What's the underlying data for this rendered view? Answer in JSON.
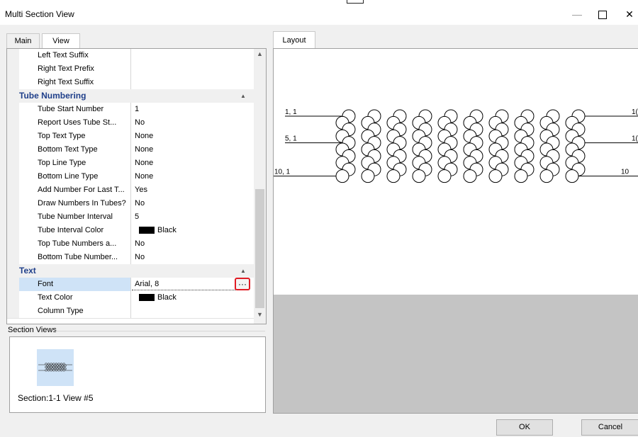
{
  "window": {
    "title": "Multi Section View"
  },
  "left_tabs": [
    {
      "label": "Main"
    },
    {
      "label": "View"
    }
  ],
  "properties": [
    {
      "type": "prop",
      "name": "Left Text Suffix",
      "value": ""
    },
    {
      "type": "prop",
      "name": "Right Text Prefix",
      "value": ""
    },
    {
      "type": "prop",
      "name": "Right Text Suffix",
      "value": ""
    },
    {
      "type": "cat",
      "name": "Tube Numbering"
    },
    {
      "type": "prop",
      "name": "Tube Start Number",
      "value": "1"
    },
    {
      "type": "prop",
      "name": "Report Uses Tube St...",
      "value": "No"
    },
    {
      "type": "prop",
      "name": "Top Text Type",
      "value": "None"
    },
    {
      "type": "prop",
      "name": "Bottom Text Type",
      "value": "None"
    },
    {
      "type": "prop",
      "name": "Top Line Type",
      "value": "None"
    },
    {
      "type": "prop",
      "name": "Bottom Line Type",
      "value": "None"
    },
    {
      "type": "prop",
      "name": "Add Number For Last T...",
      "value": "Yes"
    },
    {
      "type": "prop",
      "name": "Draw Numbers In Tubes?",
      "value": "No"
    },
    {
      "type": "prop",
      "name": "Tube Number Interval",
      "value": "5"
    },
    {
      "type": "color",
      "name": "Tube Interval Color",
      "value": "Black",
      "swatch": "#000000"
    },
    {
      "type": "prop",
      "name": "Top Tube Numbers a...",
      "value": "No"
    },
    {
      "type": "prop",
      "name": "Bottom Tube Number...",
      "value": "No"
    },
    {
      "type": "cat",
      "name": "Text"
    },
    {
      "type": "font",
      "name": "Font",
      "value": "Arial, 8"
    },
    {
      "type": "color",
      "name": "Text Color",
      "value": "Black",
      "swatch": "#000000"
    },
    {
      "type": "prop",
      "name": "Column Type",
      "value": ""
    }
  ],
  "section_views": {
    "label": "Section Views",
    "items": [
      {
        "caption": "Section:1-1 View #5"
      }
    ]
  },
  "layout": {
    "tab_label": "Layout",
    "row_labels_left": [
      "1, 1",
      "5, 1",
      "10, 1"
    ],
    "row_labels_right": [
      "1(",
      "1(",
      "10"
    ]
  },
  "buttons": {
    "ok": "OK",
    "cancel": "Cancel"
  },
  "colors": {
    "selection": "#cfe3f7",
    "category_text": "#1f3f8a",
    "highlight_border": "#e01b24"
  }
}
